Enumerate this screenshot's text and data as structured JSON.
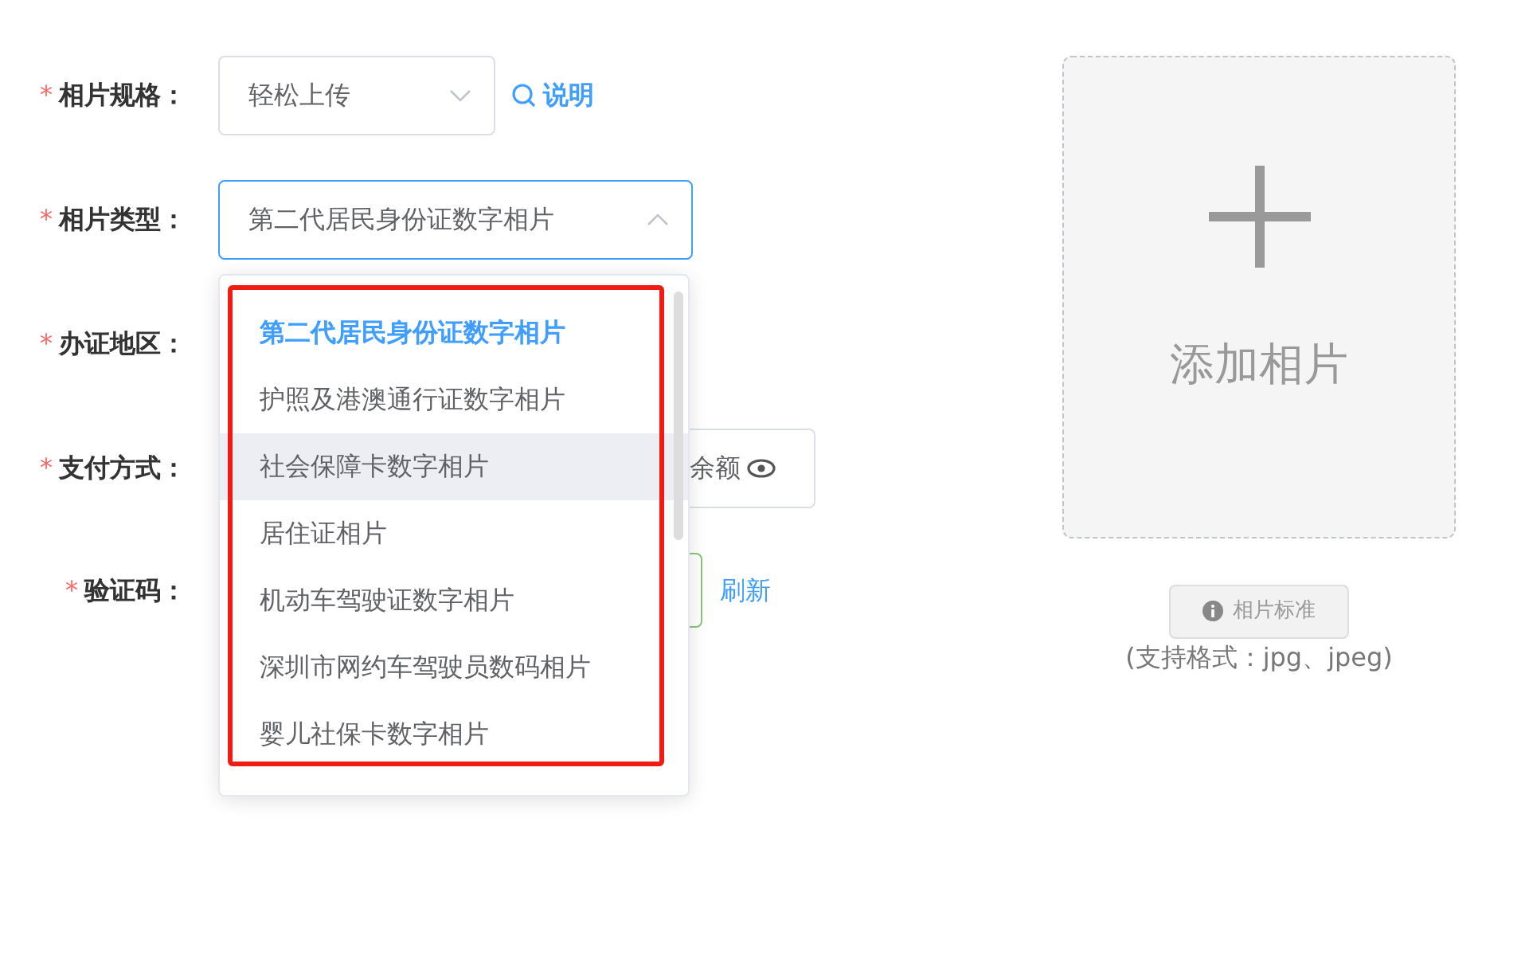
{
  "form": {
    "rows": [
      {
        "label": "相片规格：",
        "required": "*",
        "kind": "select",
        "value": "轻松上传",
        "open": false,
        "link": "说明"
      },
      {
        "label": "相片类型：",
        "required": "*",
        "kind": "select",
        "value": "第二代居民身份证数字相片",
        "open": true
      },
      {
        "label": "办证地区：",
        "required": "*",
        "kind": "covered"
      },
      {
        "label": "支付方式：",
        "required": "*",
        "kind": "balance",
        "text": "余额"
      },
      {
        "label": "验证码：",
        "required": "*",
        "kind": "captcha",
        "link": "刷新"
      }
    ]
  },
  "dropdown": {
    "highlighted": true,
    "options": [
      {
        "label": "第二代居民身份证数字相片",
        "selected": true,
        "hovered": false
      },
      {
        "label": "护照及港澳通行证数字相片",
        "selected": false,
        "hovered": false
      },
      {
        "label": "社会保障卡数字相片",
        "selected": false,
        "hovered": true
      },
      {
        "label": "居住证相片",
        "selected": false,
        "hovered": false
      },
      {
        "label": "机动车驾驶证数字相片",
        "selected": false,
        "hovered": false
      },
      {
        "label": "深圳市网约车驾驶员数码相片",
        "selected": false,
        "hovered": false
      },
      {
        "label": "婴儿社保卡数字相片",
        "selected": false,
        "hovered": false
      }
    ]
  },
  "upload": {
    "label": "添加相片",
    "standard_button": "相片标准",
    "formats": "(支持格式：jpg、jpeg)"
  }
}
